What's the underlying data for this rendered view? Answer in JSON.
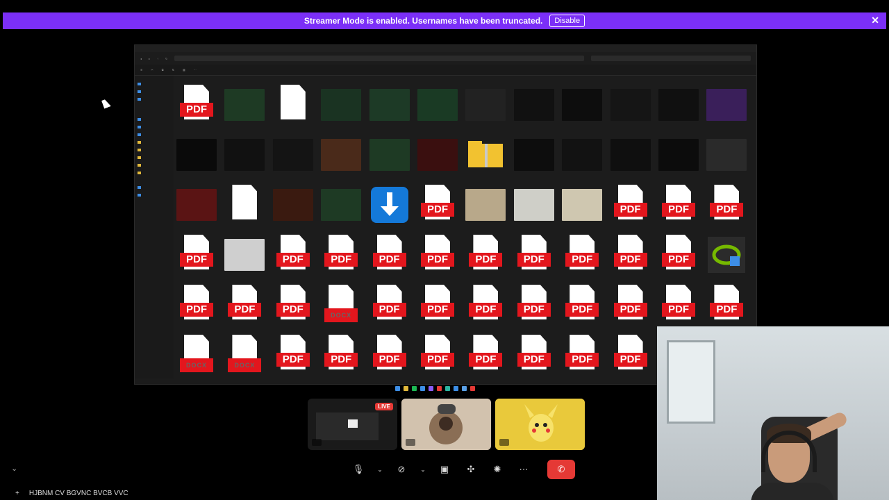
{
  "banner": {
    "message": "Streamer Mode is enabled. Usernames have been truncated.",
    "disable_label": "Disable",
    "close_glyph": "✕",
    "color": "#7b2ff7"
  },
  "tiles": {
    "live_badge": "LIVE"
  },
  "controls": {
    "mic_icon": "microphone-icon",
    "camera_icon": "camera-off-icon",
    "end_icon": "end-call-icon",
    "end_color": "#e53935"
  },
  "bottom": {
    "add_glyph": "+",
    "channel_label": "HJBNM CV BGVNC BVCB VVC"
  }
}
